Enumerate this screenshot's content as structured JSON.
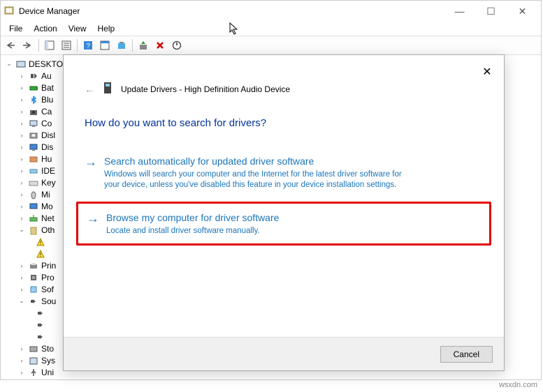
{
  "window": {
    "title": "Device Manager"
  },
  "menu": {
    "file": "File",
    "action": "Action",
    "view": "View",
    "help": "Help"
  },
  "tree": {
    "root": "DESKTO",
    "items": [
      {
        "label": "Au",
        "icon": "audio"
      },
      {
        "label": "Bat",
        "icon": "battery"
      },
      {
        "label": "Blu",
        "icon": "bluetooth"
      },
      {
        "label": "Ca",
        "icon": "camera"
      },
      {
        "label": "Co",
        "icon": "computer"
      },
      {
        "label": "Disl",
        "icon": "disk"
      },
      {
        "label": "Dis",
        "icon": "display"
      },
      {
        "label": "Hu",
        "icon": "hid"
      },
      {
        "label": "IDE",
        "icon": "ide"
      },
      {
        "label": "Key",
        "icon": "keyboard"
      },
      {
        "label": "Mi",
        "icon": "mouse"
      },
      {
        "label": "Mo",
        "icon": "monitor"
      },
      {
        "label": "Net",
        "icon": "network"
      }
    ],
    "other": {
      "label": "Oth",
      "children": [
        "",
        ""
      ]
    },
    "items2": [
      {
        "label": "Prin",
        "icon": "printer"
      },
      {
        "label": "Pro",
        "icon": "processor"
      },
      {
        "label": "Sof",
        "icon": "software"
      }
    ],
    "sound": {
      "label": "Sou",
      "children": [
        "",
        "",
        ""
      ]
    },
    "items3": [
      {
        "label": "Sto",
        "icon": "storage"
      },
      {
        "label": "Sys",
        "icon": "system"
      },
      {
        "label": "Uni",
        "icon": "usb"
      }
    ]
  },
  "dialog": {
    "title": "Update Drivers - High Definition Audio Device",
    "heading": "How do you want to search for drivers?",
    "option1": {
      "title": "Search automatically for updated driver software",
      "desc": "Windows will search your computer and the Internet for the latest driver software for your device, unless you've disabled this feature in your device installation settings."
    },
    "option2": {
      "title": "Browse my computer for driver software",
      "desc": "Locate and install driver software manually."
    },
    "cancel": "Cancel"
  },
  "watermark": "wsxdn.com"
}
